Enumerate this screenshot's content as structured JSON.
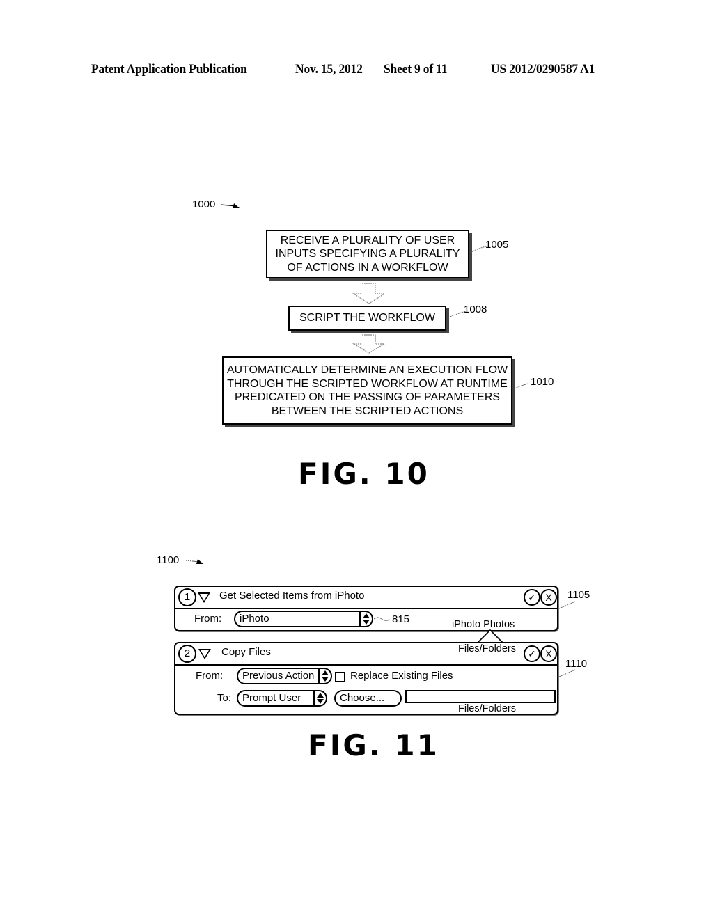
{
  "header": {
    "publication": "Patent Application Publication",
    "date": "Nov. 15, 2012",
    "sheet": "Sheet 9 of 11",
    "number": "US 2012/0290587 A1"
  },
  "fig10": {
    "ref": "1000",
    "caption": "FIG. 10",
    "steps": [
      {
        "ref": "1005",
        "text": "RECEIVE A PLURALITY OF USER INPUTS SPECIFYING A PLURALITY OF ACTIONS IN A WORKFLOW"
      },
      {
        "ref": "1008",
        "text": "SCRIPT THE WORKFLOW"
      },
      {
        "ref": "1010",
        "text": "AUTOMATICALLY DETERMINE AN EXECUTION FLOW THROUGH THE SCRIPTED WORKFLOW AT RUNTIME PREDICATED ON THE PASSING OF PARAMETERS BETWEEN THE SCRIPTED ACTIONS"
      }
    ]
  },
  "fig11": {
    "ref": "1100",
    "caption": "FIG. 11",
    "actions": [
      {
        "ref": "1105",
        "index": "1",
        "title": "Get Selected Items from iPhoto",
        "from_label": "From:",
        "from_value": "iPhoto",
        "popup_ref": "815",
        "output_type": "iPhoto Photos",
        "confirm_icon": "✓",
        "close_icon": "X"
      },
      {
        "ref": "1110",
        "index": "2",
        "title": "Copy Files",
        "input_type": "Files/Folders",
        "from_label": "From:",
        "from_value": "Previous Action",
        "replace_label": "Replace Existing Files",
        "replace_checked": false,
        "to_label": "To:",
        "to_value": "Prompt User",
        "choose_label": "Choose...",
        "path_value": "",
        "output_type": "Files/Folders",
        "confirm_icon": "✓",
        "close_icon": "X"
      }
    ]
  }
}
